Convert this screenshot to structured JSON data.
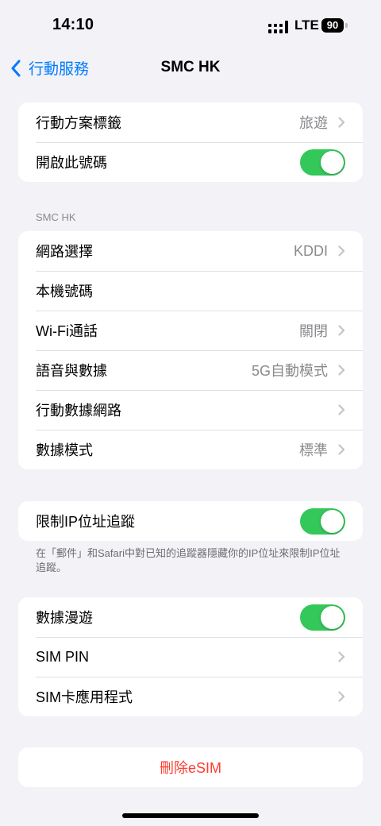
{
  "status_bar": {
    "time": "14:10",
    "network": "LTE",
    "battery": "90"
  },
  "nav": {
    "back_label": "行動服務",
    "title": "SMC HK"
  },
  "group1": [
    {
      "label": "行動方案標籤",
      "value": "旅遊",
      "chevron": true
    },
    {
      "label": "開啟此號碼",
      "toggle": "on"
    }
  ],
  "section2_header": "SMC HK",
  "group2": [
    {
      "label": "網路選擇",
      "value": "KDDI",
      "chevron": true
    },
    {
      "label": "本機號碼"
    },
    {
      "label": "Wi-Fi通話",
      "value": "關閉",
      "chevron": true
    },
    {
      "label": "語音與數據",
      "value": "5G自動模式",
      "chevron": true
    },
    {
      "label": "行動數據網路",
      "value": "",
      "chevron": true
    },
    {
      "label": "數據模式",
      "value": "標準",
      "chevron": true
    }
  ],
  "group3": [
    {
      "label": "限制IP位址追蹤",
      "toggle": "on"
    }
  ],
  "group3_footer": "在「郵件」和Safari中對已知的追蹤器隱藏你的IP位址來限制IP位址追蹤。",
  "group4": [
    {
      "label": "數據漫遊",
      "toggle": "on"
    },
    {
      "label": "SIM PIN",
      "chevron": true
    },
    {
      "label": "SIM卡應用程式",
      "chevron": true
    }
  ],
  "delete_label": "刪除eSIM",
  "colors": {
    "accent": "#007aff",
    "toggle_on": "#34c759",
    "destructive": "#ff3b30",
    "background": "#f2f2f7"
  },
  "icons": {
    "back": "chevron-left-icon",
    "row": "chevron-right-icon",
    "signal": "cellular-signal-icon",
    "battery": "battery-icon"
  }
}
